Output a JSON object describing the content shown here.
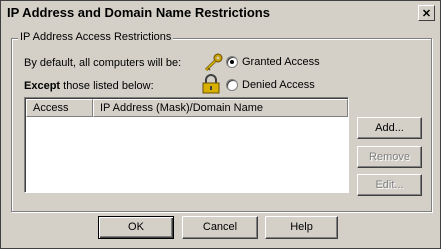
{
  "window": {
    "title": "IP Address and Domain Name Restrictions",
    "close_glyph": "✕"
  },
  "group": {
    "label": "IP Address Access Restrictions",
    "default_label": "By default, all computers will be:",
    "except_bold": "Except",
    "except_rest": " those listed below:",
    "granted_label": "Granted Access",
    "denied_label": "Denied Access",
    "granted_selected": true,
    "icons": {
      "granted": "key-icon",
      "denied": "padlock-icon"
    }
  },
  "list": {
    "columns": [
      "Access",
      "IP Address (Mask)/Domain Name"
    ],
    "rows": []
  },
  "side_buttons": {
    "add": "Add...",
    "remove": "Remove",
    "edit": "Edit..."
  },
  "footer": {
    "ok": "OK",
    "cancel": "Cancel",
    "help": "Help"
  },
  "colors": {
    "face": "#d4d0c8",
    "key_gold": "#c8a000",
    "lock_gold": "#d8b000"
  }
}
